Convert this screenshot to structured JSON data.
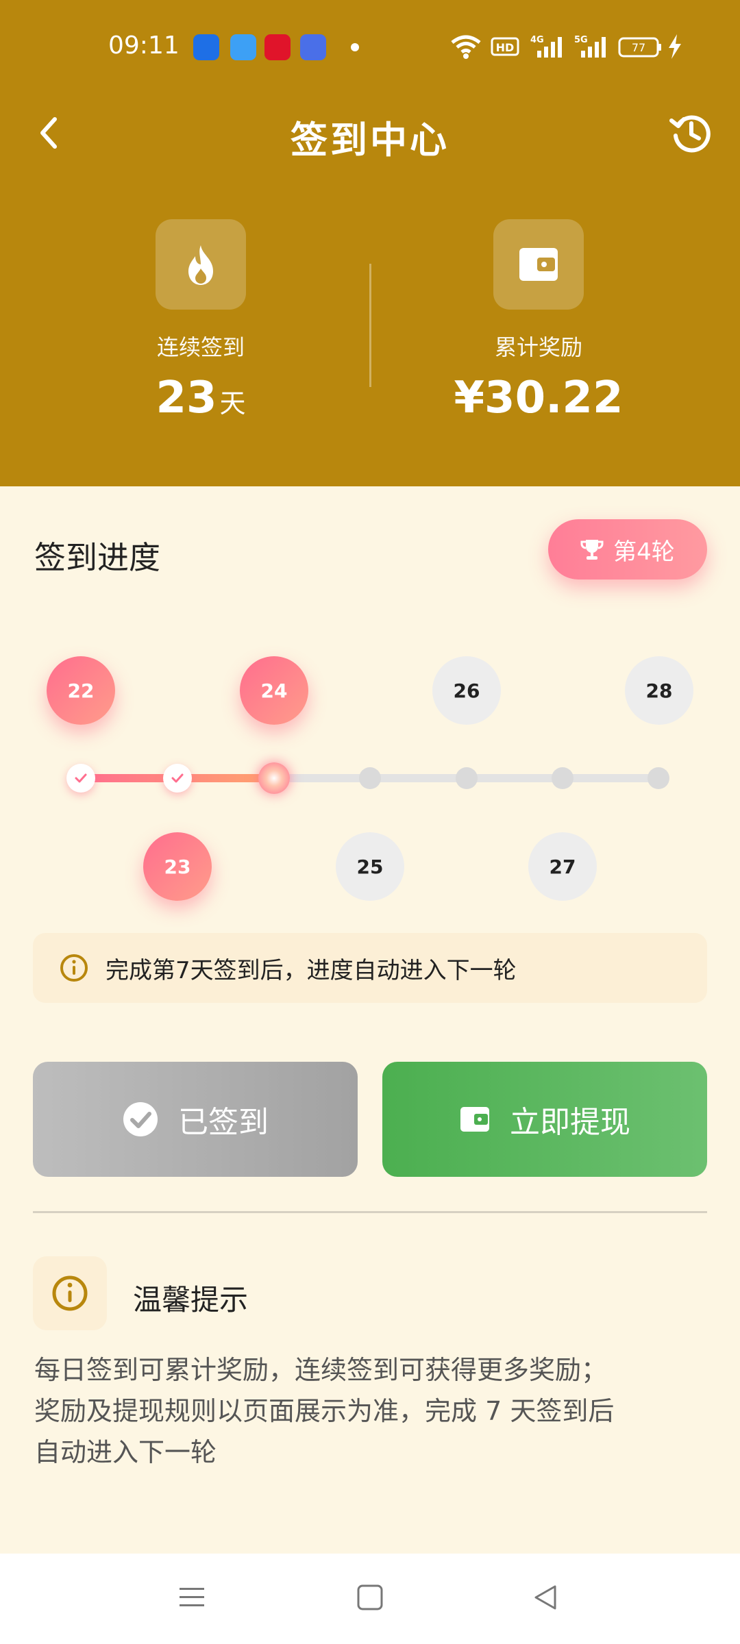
{
  "status_bar": {
    "time": "09:11",
    "battery": "77",
    "network_4g": "4G",
    "network_5g": "5G",
    "hd": "HD"
  },
  "header": {
    "title": "签到中心",
    "back_icon": "chevron-left-icon",
    "history_icon": "history-icon"
  },
  "stats": {
    "streak_label": "连续签到",
    "streak_value": "23",
    "streak_unit": "天",
    "reward_label": "累计奖励",
    "reward_value": "¥30.22"
  },
  "progress": {
    "title": "签到进度",
    "round_badge": "第4轮",
    "days_top": [
      "22",
      "24",
      "26",
      "28"
    ],
    "days_bottom": [
      "23",
      "25",
      "27"
    ],
    "completed_days": 3,
    "total_days": 7,
    "tip": "完成第7天签到后，进度自动进入下一轮"
  },
  "actions": {
    "signed_label": "已签到",
    "withdraw_label": "立即提现"
  },
  "warm_tips": {
    "title": "温馨提示",
    "body_line1": "每日签到可累计奖励，连续签到可获得更多奖励；",
    "body_line2": "奖励及提现规则以页面展示为准，完成 7 天签到后",
    "body_line3": "自动进入下一轮"
  },
  "colors": {
    "header_bg": "#B8870D",
    "page_bg": "#FDF6E3",
    "accent_pink": "#FF6E8E",
    "withdraw_green": "#4CAF50"
  }
}
